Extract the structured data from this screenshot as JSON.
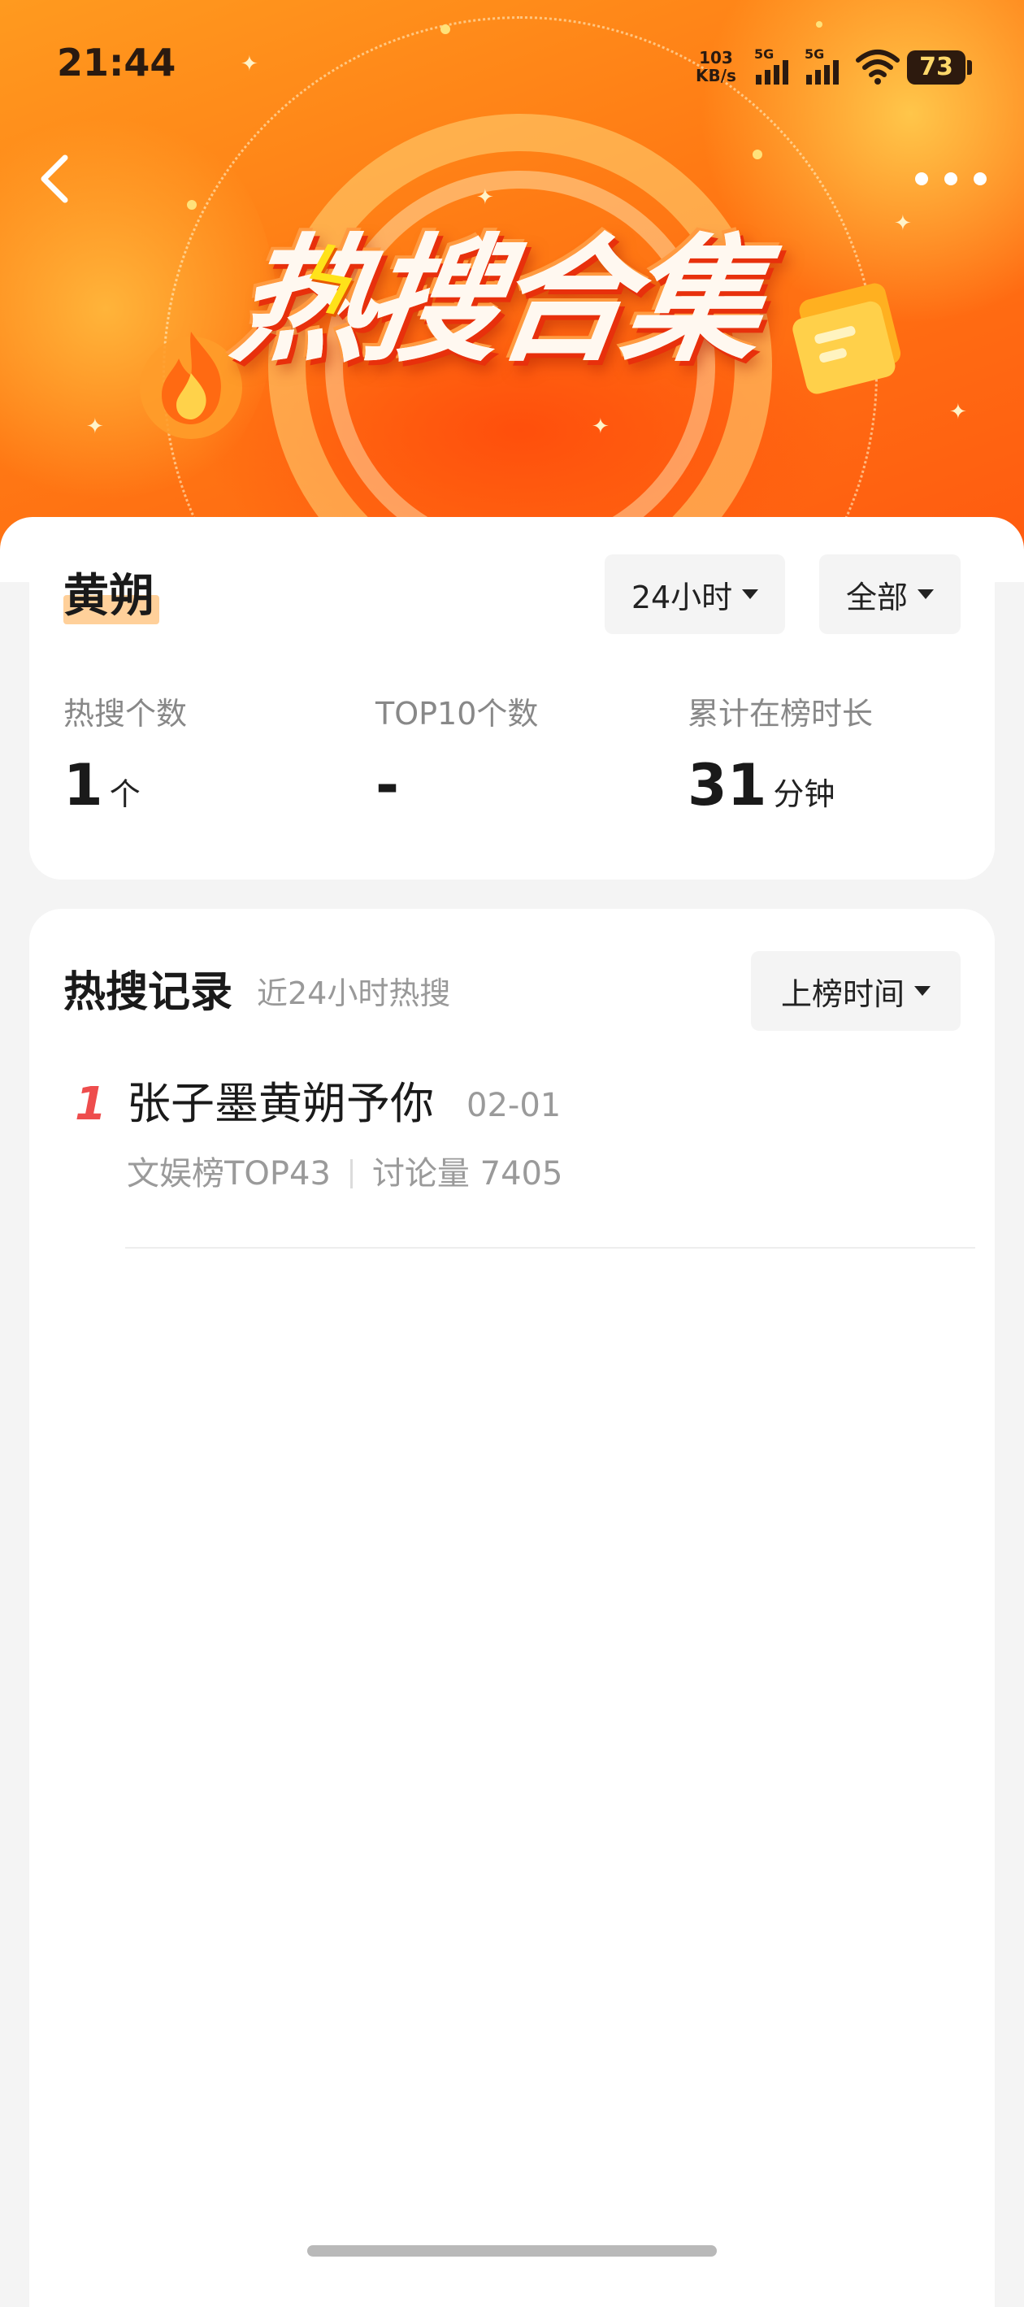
{
  "status_bar": {
    "time": "21:44",
    "net_speed_value": "103",
    "net_speed_unit": "KB/s",
    "sim1_label": "5G",
    "sim2_label": "5G",
    "battery": "73"
  },
  "banner": {
    "title": "热搜合集"
  },
  "summary": {
    "name": "黄朔",
    "range_filter": "24小时",
    "type_filter": "全部",
    "stats": [
      {
        "label": "热搜个数",
        "value": "1",
        "unit": "个"
      },
      {
        "label": "TOP10个数",
        "value": "-",
        "unit": ""
      },
      {
        "label": "累计在榜时长",
        "value": "31",
        "unit": "分钟"
      }
    ]
  },
  "records": {
    "title": "热搜记录",
    "subtitle": "近24小时热搜",
    "sort_label": "上榜时间",
    "items": [
      {
        "rank": "1",
        "title": "张子墨黄朔予你",
        "date": "02-01",
        "board": "文娱榜TOP43",
        "discussion": "讨论量 7405"
      }
    ]
  },
  "colors": {
    "banner_orange": "#ff7a14",
    "rank_red": "#ee4d4d",
    "highlight": "#ffd09a"
  }
}
